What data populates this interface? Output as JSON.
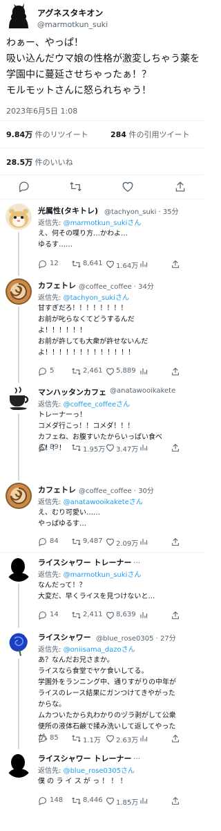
{
  "main": {
    "author_name": "アグネスタキオン",
    "author_handle": "@marmotkun_suki",
    "text_line1": "わぁー、やっぱ！",
    "text_line2": "吸い込んだウマ娘の性格が激変しちゃう薬を",
    "text_line3": "学園中に蔓延させちゃったぁ！？",
    "text_line4": "モルモットさんに怒られちゃう！",
    "timestamp": "2023年6月5日 1:08",
    "retweets_num": "9.84万",
    "retweets_label": " 件のリツイート",
    "quotes_num": "284",
    "quotes_label": " 件の引用ツイート",
    "likes_num": "28.5万",
    "likes_label": " 件のいいね"
  },
  "replying_prefix": "返信先: ",
  "replies": [
    {
      "name": "光属性(タキトレ)",
      "handle": "@tachyon_suki · 35分",
      "reply_to": "@marmotkun_sukiさん",
      "text": "え、何その喋り方…かわよ…\nゆるす……",
      "replies": "12",
      "retweets": "8,641",
      "likes": "1.64万"
    },
    {
      "name": "カフェトレ",
      "handle": "@coffee_coffee · 34分",
      "reply_to": "@tachyon_sukiさん",
      "text": "甘すぎだろ！！！！！！！！\nお前が叱らなくてどうするんだ\nよ！！！！！！\nお前が許しても大衆が許せないんだ\nよ！！！！！！！！！！！！！",
      "replies": "5",
      "retweets": "2,461",
      "likes": "5,889"
    },
    {
      "name": "マンハッタンカフェ",
      "handle": "@anatawooikakete",
      "reply_to": "@coffee_coffeeさん",
      "text": "トレーナーっ！\nコメダ行こっ！！コメダ！！！\nカフェね、お腹すいたからいっぱい食べ\nる！！！",
      "replies": "89",
      "retweets": "1.95万",
      "likes": "3.47万"
    },
    {
      "name": "カフェトレ",
      "handle": "@coffee_coffee · 30分",
      "reply_to": "@anatawooikaketeさん",
      "text": "え、むり可愛い……\nやっぱゆるす…",
      "replies": "84",
      "retweets": "9,487",
      "likes": "2.09万"
    },
    {
      "name": "ライスシャワー トレーナー",
      "handle": "…",
      "reply_to": "@marmotkun_sukiさん",
      "text": "なんだって！？\n大変だ、早くライスを見つけないと…",
      "replies": "14",
      "retweets": "2,411",
      "likes": "8,639"
    },
    {
      "name": "ライスシャワー",
      "handle": "@blue_rose0305 · 27分",
      "reply_to": "@oniisama_dazoさん",
      "text": "あ？なんだお兄さまか。\nライスなら食堂でヤケ食いしてる。\n学園外をランニング中、通りすがりの中年が\nライスのレース結果にガンつけてきやがった\nからな。\nムカついたから丸わかりのヅラ剥がして公衆\n便所の液体石鹸で揉み洗いして返してやった\nが。",
      "replies": "85",
      "retweets": "1.1万",
      "likes": "2.63万"
    },
    {
      "name": "ライスシャワー トレーナー",
      "handle": "…",
      "reply_to": "@blue_rose0305さん",
      "text": "僕 の ラ イ ス が っ ！ ！ ！",
      "replies": "148",
      "retweets": "8,446",
      "likes": "1.85万"
    }
  ],
  "colors": {
    "link": "#1d9bf0",
    "muted": "#536471",
    "divider": "#eff3f4",
    "thread": "#cfd9de"
  }
}
